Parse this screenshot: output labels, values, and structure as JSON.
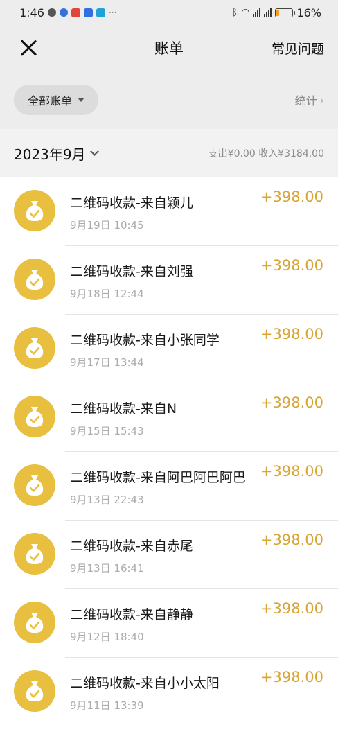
{
  "status_bar": {
    "time": "1:46",
    "dots": "···",
    "battery": "16%",
    "battery_level": 0.16,
    "signal_tag": "4G"
  },
  "nav": {
    "title": "账单",
    "help_label": "常见问题"
  },
  "filter": {
    "scope_label": "全部账单",
    "stats_label": "统计",
    "chevron": "›"
  },
  "month": {
    "label": "2023年9月",
    "summary": "支出¥0.00 收入¥3184.00"
  },
  "transactions": [
    {
      "title": "二维码收款-来自颖儿",
      "time": "9月19日 10:45",
      "amount": "+398.00"
    },
    {
      "title": "二维码收款-来自刘强",
      "time": "9月18日 12:44",
      "amount": "+398.00"
    },
    {
      "title": "二维码收款-来自小张同学",
      "time": "9月17日 13:44",
      "amount": "+398.00"
    },
    {
      "title": "二维码收款-来自N",
      "time": "9月15日 15:43",
      "amount": "+398.00"
    },
    {
      "title": "二维码收款-来自阿巴阿巴阿巴",
      "time": "9月13日 22:43",
      "amount": "+398.00"
    },
    {
      "title": "二维码收款-来自赤尾",
      "time": "9月13日 16:41",
      "amount": "+398.00"
    },
    {
      "title": "二维码收款-来自静静",
      "time": "9月12日 18:40",
      "amount": "+398.00"
    },
    {
      "title": "二维码收款-来自小小太阳",
      "time": "9月11日 13:39",
      "amount": "+398.00"
    }
  ],
  "colors": {
    "accent_amount": "#d7a636",
    "avatar_bg": "#e8bf3e"
  },
  "icons": {
    "row_icon": "money-bag-check-icon"
  }
}
